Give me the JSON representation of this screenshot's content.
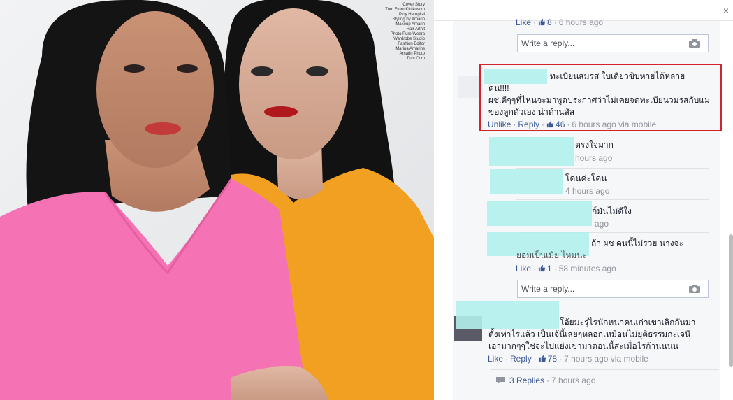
{
  "header": {
    "close_glyph": "×"
  },
  "photo": {
    "magazine_text": [
      "Cover Story",
      "Tum From Kittikosum",
      "Ploy Harnpilai",
      "Styling by Amarin",
      "Makeup Amarin",
      "Hair Arthit",
      "Photo Pure Weera",
      "Wardrobe Studio",
      "Fashion Editor",
      "Marina Amarins",
      "Amarin Photo",
      "Tum Com"
    ]
  },
  "comments": {
    "top_meta": {
      "like": "Like",
      "likes": "8",
      "time": "6 hours ago"
    },
    "reply_placeholder": "Write a reply...",
    "main": {
      "line1": "ทะเบียนสมรส ใบเดียวขิบหายได้หลาย",
      "line2": "คน!!!!",
      "line3": "ผช.ดีๆๆที่ไหนจะมาพูดประกาศว่าไม่เคยจดทะเบียนวมรสกับแม่",
      "line4": "ของลูกตัวเอง น่าด้านสัส",
      "unlike": "Unlike",
      "reply": "Reply",
      "likes": "46",
      "time": "6 hours ago via mobile"
    },
    "reply1": {
      "text": "ตรงใจมาก",
      "time": "hours ago"
    },
    "reply2": {
      "text": "โดนค่ะโดน",
      "time": "4 hours ago"
    },
    "reply3": {
      "text": "ก์มันไม่ดีใง",
      "time": "ago"
    },
    "reply4": {
      "line1": "ถ้า ผช คนนี้ไม่รวย นางจะ",
      "line2": "ยอมเป็นเมีย ไหมนะ",
      "like": "Like",
      "likes": "1",
      "time": "58 minutes ago"
    },
    "comment2": {
      "line1": "โอ้ยมะรุ่ไรนักหนาคนเก่าเขาเลิกกันมา",
      "line2": "ตั้งเท่าไรแล้ว เป็นเจ้นี้เลยๆหลอกเหมือนไม่ยุติธรรมกะเจนี",
      "line3": "เอามากๆๆใช่จะไปแย่งเขามาตอนนี้สะเมื่อไรก้านนนน",
      "like": "Like",
      "reply": "Reply",
      "likes": "78",
      "time": "7 hours ago via mobile"
    },
    "replies_link": {
      "label": "3 Replies",
      "time": "7 hours ago"
    }
  },
  "colors": {
    "link": "#3b5998",
    "highlight": "#d3242b",
    "redacted": "#b3f0ec"
  }
}
